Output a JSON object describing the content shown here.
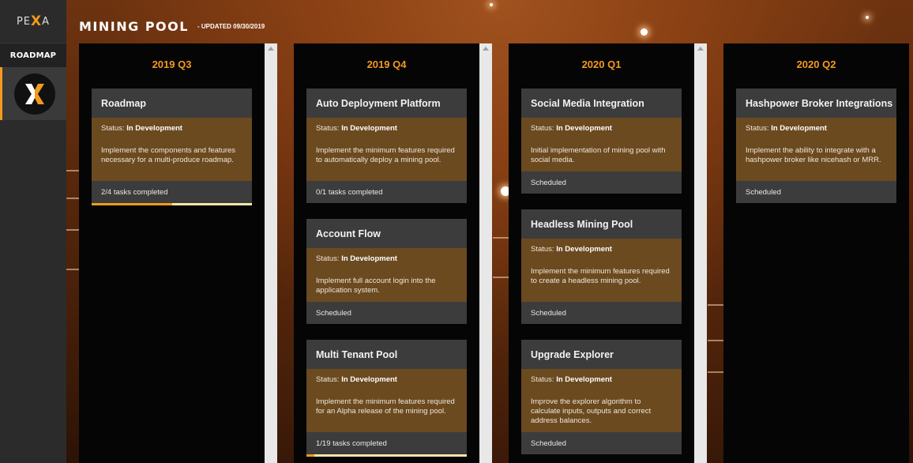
{
  "app": {
    "logo_text_left": "PE",
    "logo_text_x": "X",
    "logo_text_right": "A",
    "title": "MINING POOL",
    "updated": "- UPDATED 09/30/2019"
  },
  "sidebar": {
    "nav_label": "ROADMAP",
    "active_icon": "pexa-x-icon"
  },
  "colors": {
    "accent": "#f39a1e",
    "card_body": "#6b4a20",
    "card_header": "#3c3c3c",
    "column_bg": "#050505"
  },
  "columns": [
    {
      "label": "2019 Q3",
      "cards": [
        {
          "title": "Roadmap",
          "status_prefix": "Status:",
          "status": "In Development",
          "description": "Implement the components and features necessary for a multi-produce roadmap.",
          "footer": "2/4 tasks completed",
          "progress": 0.5
        }
      ]
    },
    {
      "label": "2019 Q4",
      "cards": [
        {
          "title": "Auto Deployment Platform",
          "status_prefix": "Status:",
          "status": "In Development",
          "description": "Implement the minimum features required to automatically deploy a mining pool.",
          "footer": "0/1 tasks completed"
        },
        {
          "title": "Account Flow",
          "status_prefix": "Status:",
          "status": "In Development",
          "description": "Implement full account login into the application system.",
          "footer": "Scheduled"
        },
        {
          "title": "Multi Tenant Pool",
          "status_prefix": "Status:",
          "status": "In Development",
          "description": "Implement the minimum features required for an Alpha release of the mining pool.",
          "footer": "1/19 tasks completed",
          "progress": 0.05
        }
      ]
    },
    {
      "label": "2020 Q1",
      "cards": [
        {
          "title": "Social Media Integration",
          "status_prefix": "Status:",
          "status": "In Development",
          "description": "Initial implementation of mining pool with social media.",
          "footer": "Scheduled"
        },
        {
          "title": "Headless Mining Pool",
          "status_prefix": "Status:",
          "status": "In Development",
          "description": "Implement the minimum features required to create a headless mining pool.",
          "footer": "Scheduled"
        },
        {
          "title": "Upgrade Explorer",
          "status_prefix": "Status:",
          "status": "In Development",
          "description": "Improve the explorer algorithm to calculate inputs, outputs and correct address balances.",
          "footer": "Scheduled"
        }
      ]
    },
    {
      "label": "2020 Q2",
      "cards": [
        {
          "title": "Hashpower Broker Integrations",
          "status_prefix": "Status:",
          "status": "In Development",
          "description": "Implement the ability to integrate with a hashpower broker like nicehash or MRR.",
          "footer": "Scheduled"
        }
      ]
    }
  ]
}
